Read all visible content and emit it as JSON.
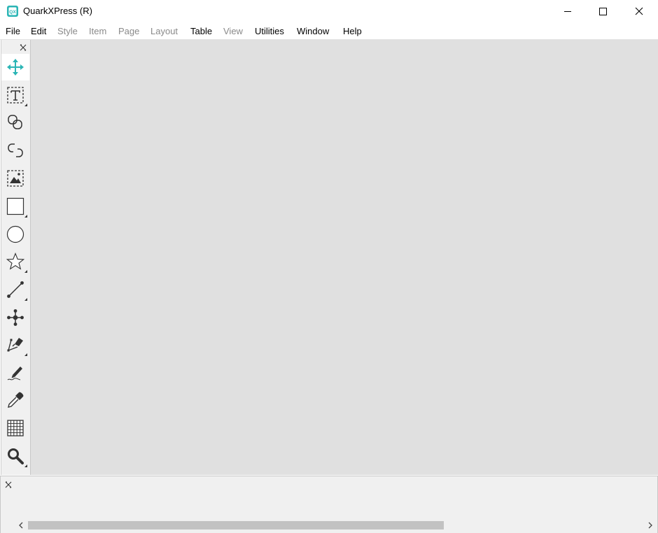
{
  "window": {
    "title": "QuarkXPress (R)",
    "app_icon": "quarkxpress-logo-icon",
    "controls": [
      "minimize-icon",
      "maximize-icon",
      "close-icon"
    ]
  },
  "menu": {
    "items": [
      {
        "label": "File",
        "enabled": true
      },
      {
        "label": "Edit",
        "enabled": true
      },
      {
        "label": "Style",
        "enabled": false
      },
      {
        "label": "Item",
        "enabled": false
      },
      {
        "label": "Page",
        "enabled": false
      },
      {
        "label": "Layout",
        "enabled": false
      },
      {
        "label": "Table",
        "enabled": true
      },
      {
        "label": "View",
        "enabled": false
      },
      {
        "label": "Utilities",
        "enabled": true
      },
      {
        "label": "Window",
        "enabled": true
      },
      {
        "label": "Help",
        "enabled": true
      }
    ]
  },
  "tools": [
    {
      "icon": "move-item-tool-icon",
      "active": true
    },
    {
      "icon": "text-content-tool-icon",
      "has_submenu": true
    },
    {
      "icon": "linking-tool-icon"
    },
    {
      "icon": "unlinking-tool-icon"
    },
    {
      "icon": "picture-content-tool-icon"
    },
    {
      "icon": "rectangle-box-tool-icon",
      "has_submenu": true
    },
    {
      "icon": "oval-box-tool-icon"
    },
    {
      "icon": "starburst-tool-icon",
      "has_submenu": true
    },
    {
      "icon": "line-tool-icon",
      "has_submenu": true
    },
    {
      "icon": "bezier-point-tool-icon"
    },
    {
      "icon": "pen-tool-icon",
      "has_submenu": true
    },
    {
      "icon": "freehand-drawing-tool-icon"
    },
    {
      "icon": "eyedropper-tool-icon"
    },
    {
      "icon": "table-tool-icon"
    },
    {
      "icon": "zoom-tool-icon",
      "has_submenu": true
    }
  ],
  "colors": {
    "accent": "#2bb5b5",
    "workspace": "#e0e0e0",
    "palette": "#f0f0f0"
  }
}
